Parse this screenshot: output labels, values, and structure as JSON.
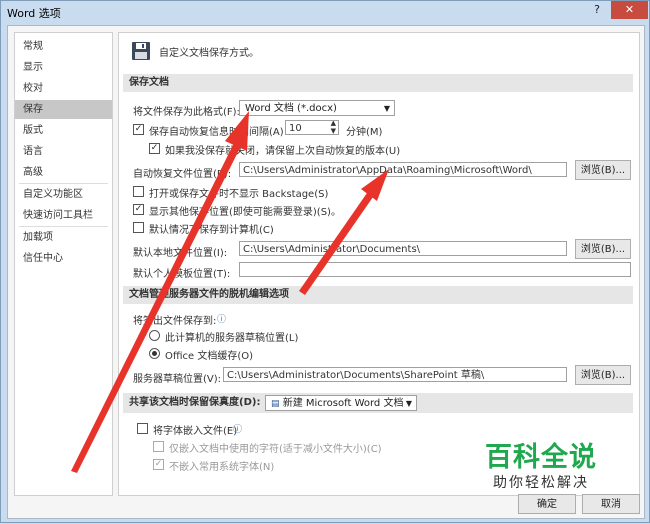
{
  "window": {
    "title": "Word 选项",
    "help": "?",
    "close": "✕"
  },
  "nav": {
    "items": [
      {
        "label": "常规"
      },
      {
        "label": "显示"
      },
      {
        "label": "校对"
      },
      {
        "label": "保存"
      },
      {
        "label": "版式"
      },
      {
        "label": "语言"
      },
      {
        "label": "高级"
      },
      {
        "label": "自定义功能区"
      },
      {
        "label": "快速访问工具栏"
      },
      {
        "label": "加载项"
      },
      {
        "label": "信任中心"
      }
    ],
    "selected": "保存"
  },
  "header": {
    "text": "自定义文档保存方式。"
  },
  "save_docs": {
    "section": "保存文档",
    "format_label": "将文件保存为此格式(F):",
    "format_value": "Word 文档 (*.docx)",
    "autorecover_label": "保存自动恢复信息时间间隔(A)",
    "autorecover_checked": true,
    "autorecover_minutes": "10",
    "minutes_label": "分钟(M)",
    "keep_last_label": "如果我没保存就关闭，请保留上次自动恢复的版本(U)",
    "keep_last_checked": true,
    "autorecover_loc_label": "自动恢复文件位置(R):",
    "autorecover_loc_value": "C:\\Users\\Administrator\\AppData\\Roaming\\Microsoft\\Word\\",
    "browse": "浏览(B)...",
    "no_backstage_label": "打开或保存文件时不显示 Backstage(S)",
    "no_backstage_checked": false,
    "show_more_label": "显示其他保存位置(即使可能需要登录)(S)。",
    "show_more_checked": true,
    "default_local_label": "默认情况下保存到计算机(C)",
    "default_local_checked": false,
    "local_loc_label": "默认本地文件位置(I):",
    "local_loc_value": "C:\\Users\\Administrator\\Documents\\",
    "template_loc_label": "默认个人模板位置(T):",
    "template_loc_value": ""
  },
  "offline": {
    "section": "文档管理服务器文件的脱机编辑选项",
    "checkout_label": "将签出文件保存到:",
    "server_drafts": "此计算机的服务器草稿位置(L)",
    "office_cache": "Office 文档缓存(O)",
    "drafts_loc_label": "服务器草稿位置(V):",
    "drafts_loc_value": "C:\\Users\\Administrator\\Documents\\SharePoint 草稿\\",
    "browse": "浏览(B)..."
  },
  "fidelity": {
    "section": "共享该文档时保留保真度(D):",
    "doc_value": "新建 Microsoft Word 文档",
    "embed_fonts_label": "将字体嵌入文件(E)",
    "embed_fonts_checked": false,
    "embed_used_label": "仅嵌入文档中使用的字符(适于减小文件大小)(C)",
    "no_common_label": "不嵌入常用系统字体(N)",
    "no_common_checked": true
  },
  "footer": {
    "ok": "确定",
    "cancel": "取消"
  },
  "watermark": {
    "line1": "百科全说",
    "line2": "助你轻松解决"
  },
  "colors": {
    "arrow": "#e8332b",
    "watermark": "#1fa84e",
    "selected_nav": "#c7c7c7"
  }
}
